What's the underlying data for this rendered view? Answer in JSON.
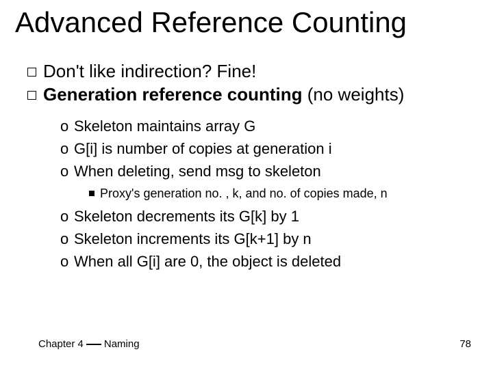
{
  "title": "Advanced Reference Counting",
  "bullets": {
    "b1": "Don't like indirection? Fine!",
    "b2_prefix": "Generation reference counting",
    "b2_suffix": " (no weights)"
  },
  "sub_a": {
    "s1": "Skeleton maintains array G",
    "s2": "G[i] is number of copies at generation i",
    "s3": "When deleting, send msg to skeleton"
  },
  "subsub": "Proxy's generation no. , k, and no. of copies made, n",
  "sub_b": {
    "s4": "Skeleton decrements its G[k] by 1",
    "s5": "Skeleton increments its G[k+1] by n",
    "s6": "When all G[i] are 0, the object is deleted"
  },
  "marker_o": "o",
  "footer": {
    "chapter_left": "Chapter 4",
    "chapter_right": "Naming",
    "page": "78"
  }
}
